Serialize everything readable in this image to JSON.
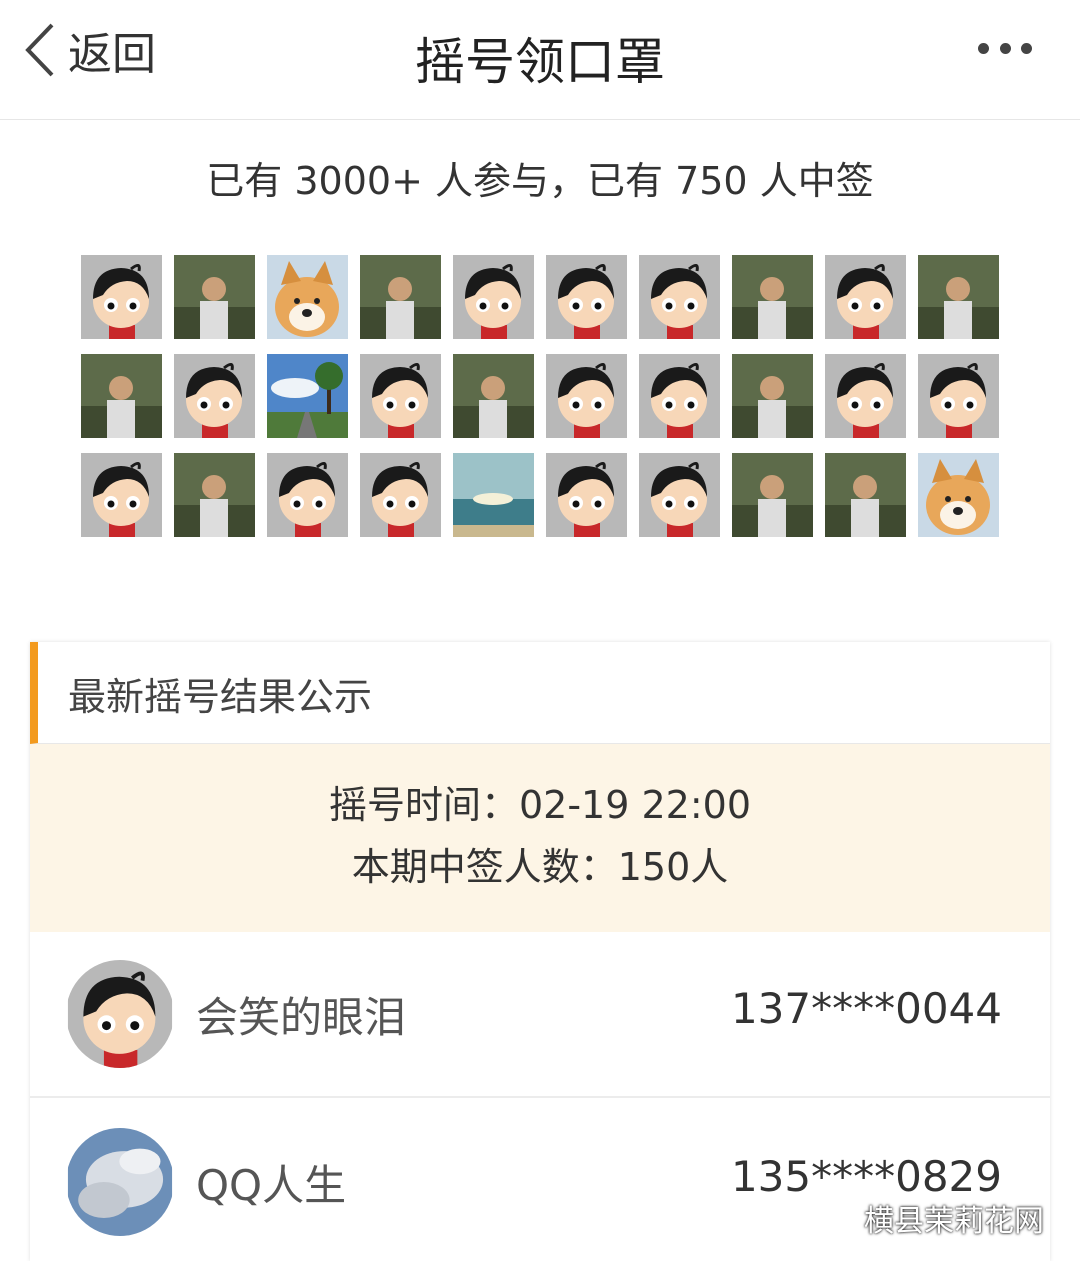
{
  "header": {
    "back_label": "返回",
    "title": "摇号领口罩",
    "more_icon": "more-dots-icon"
  },
  "summary": "已有 3000+ 人参与，已有 750 人中签",
  "participants": [
    "default",
    "photo",
    "dog",
    "photo",
    "default",
    "default",
    "default",
    "photo",
    "default",
    "photo",
    "photo",
    "default",
    "landscape",
    "default",
    "photo",
    "default",
    "default",
    "photo",
    "default",
    "default",
    "default",
    "photo",
    "default",
    "default",
    "sea",
    "default",
    "default",
    "photo",
    "photo",
    "dog"
  ],
  "results": {
    "heading": "最新摇号结果公示",
    "draw_time": "摇号时间：02-19 22:00",
    "winners_count": "本期中签人数：150人",
    "winners": [
      {
        "name": "会笑的眼泪",
        "phone": "137****0044",
        "avatar": "default"
      },
      {
        "name": "QQ人生",
        "phone": "135****0829",
        "avatar": "photo"
      }
    ]
  },
  "watermark": "横县茉莉花网",
  "colors": {
    "accent": "#f39a1e",
    "info_bg": "#fdf5e6"
  }
}
